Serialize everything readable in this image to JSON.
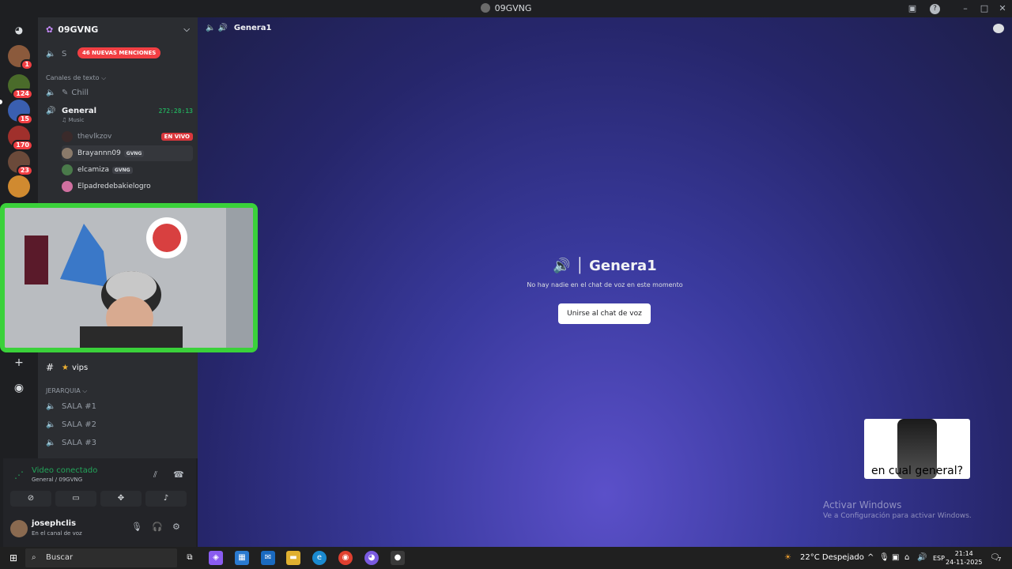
{
  "window": {
    "title": "09GVNG"
  },
  "server": {
    "name": "09GVNG",
    "new_mentions": "46 NUEVAS MENCIONES"
  },
  "guild_badges": [
    "1",
    "124",
    "15",
    "170",
    "23"
  ],
  "categories": {
    "text": "Canales de texto",
    "hierarchy": "JERARQUIA"
  },
  "channels": {
    "top": "S",
    "chill": "Chill",
    "general": "General",
    "general_time": "272:28:13",
    "general_activity": "Music",
    "vips": "vips",
    "sala1": "SALA #1",
    "sala2": "SALA #2",
    "sala3": "SALA #3"
  },
  "voice_users": [
    {
      "name": "thevlkzov",
      "live": "EN VIVO"
    },
    {
      "name": "Brayannn09",
      "tag": "GVNG"
    },
    {
      "name": "elcamiza",
      "tag": "GVNG"
    },
    {
      "name": "Elpadredebakielogro"
    }
  ],
  "voice_panel": {
    "status": "Video conectado",
    "location": "General / 09GVNG",
    "username": "josephclis",
    "user_status": "En el canal de voz"
  },
  "main": {
    "header": "Genera1",
    "title": "Genera1",
    "subtitle": "No hay nadie en el chat de voz en este momento",
    "join_label": "Unirse al chat de voz"
  },
  "sticker_caption": "en cual general?",
  "windows_activation": {
    "title": "Activar Windows",
    "subtitle": "Ve a Configuración para activar Windows."
  },
  "taskbar": {
    "search": "Buscar",
    "weather": "22°C  Despejado",
    "lang": "ESP",
    "time": "21:14",
    "date": "24-11-2025",
    "notifications": "7"
  },
  "colors": {
    "accent": "#5865f2",
    "green": "#23a55a",
    "red": "#f23f43",
    "webcam_border": "#3ad13a"
  }
}
